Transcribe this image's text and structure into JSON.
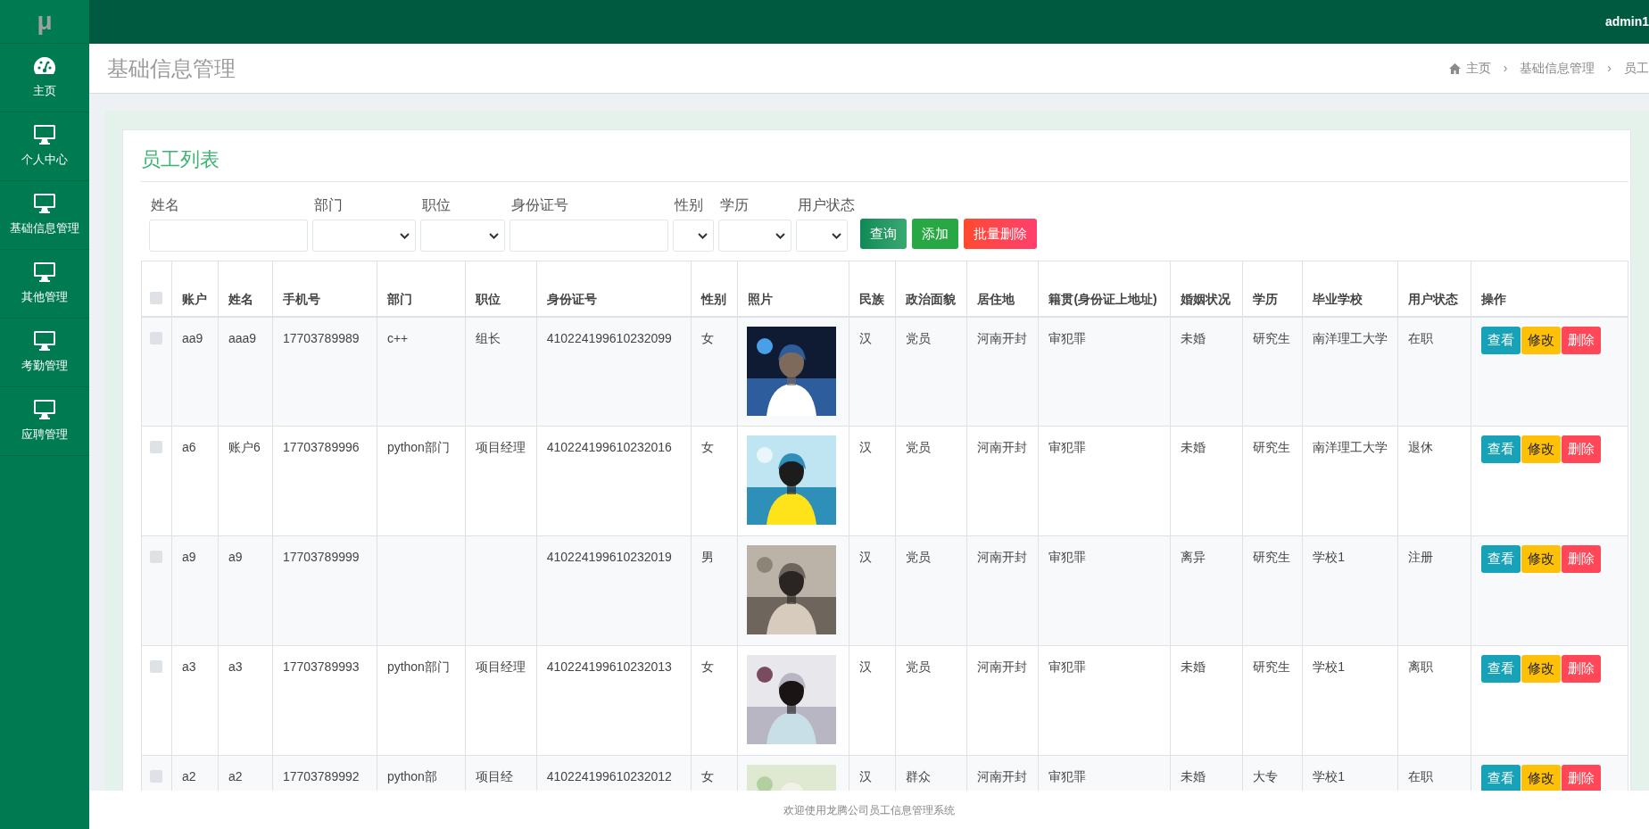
{
  "topbar": {
    "user": "admin1"
  },
  "sidebar": {
    "logo": "μ",
    "items": [
      {
        "label": "主页",
        "kind": "dashboard"
      },
      {
        "label": "个人中心",
        "kind": "monitor"
      },
      {
        "label": "基础信息管理",
        "kind": "monitor"
      },
      {
        "label": "其他管理",
        "kind": "monitor"
      },
      {
        "label": "考勤管理",
        "kind": "monitor"
      },
      {
        "label": "应聘管理",
        "kind": "monitor"
      }
    ]
  },
  "header": {
    "title": "基础信息管理",
    "breadcrumb": [
      {
        "label": "主页",
        "kind": "home"
      },
      {
        "label": "›",
        "kind": "separator"
      },
      {
        "label": "基础信息管理",
        "kind": "link"
      },
      {
        "label": "›",
        "kind": "separator"
      },
      {
        "label": "员工",
        "kind": "link"
      }
    ]
  },
  "panel": {
    "title": "员工列表",
    "filters": [
      {
        "label": "姓名",
        "kind": "text"
      },
      {
        "label": "部门",
        "kind": "select"
      },
      {
        "label": "职位",
        "kind": "select"
      },
      {
        "label": "身份证号",
        "kind": "text"
      },
      {
        "label": "性别",
        "kind": "select"
      },
      {
        "label": "学历",
        "kind": "select"
      },
      {
        "label": "用户状态",
        "kind": "select"
      }
    ],
    "buttons": [
      {
        "label": "查询",
        "kind": "search"
      },
      {
        "label": "添加",
        "kind": "add"
      },
      {
        "label": "批量删除",
        "kind": "delete"
      }
    ]
  },
  "table": {
    "select_all": {
      "checked": false
    },
    "columns": [
      {
        "label": "账户",
        "kind": "text"
      },
      {
        "label": "姓名",
        "kind": "text"
      },
      {
        "label": "手机号",
        "kind": "text"
      },
      {
        "label": "部门",
        "kind": "text"
      },
      {
        "label": "职位",
        "kind": "text"
      },
      {
        "label": "身份证号",
        "kind": "text"
      },
      {
        "label": "性别",
        "kind": "text"
      },
      {
        "label": "照片"
      },
      {
        "label": "民族",
        "kind": "text"
      },
      {
        "label": "政治面貌",
        "kind": "text"
      },
      {
        "label": "居住地",
        "kind": "text"
      },
      {
        "label": "籍贯(身份证上地址)",
        "kind": "text"
      },
      {
        "label": "婚姻状况",
        "kind": "text"
      },
      {
        "label": "学历",
        "kind": "text"
      },
      {
        "label": "毕业学校",
        "kind": "text"
      },
      {
        "label": "用户状态",
        "kind": "text"
      },
      {
        "label": "操作",
        "kind": "actions"
      }
    ],
    "rows": [
      {
        "checked": false,
        "cells": [
          "aa9",
          "aaa9",
          "17703789989",
          "c++",
          "组长",
          "410224199610232099",
          "女",
          {
            "kind": "picture"
          },
          "汉",
          "党员",
          "河南开封",
          "审犯罪",
          "未婚",
          "研究生",
          "南洋理工大学",
          "在职"
        ],
        "actions": [
          {
            "label": "查看",
            "kind": "view"
          },
          {
            "label": "修改",
            "kind": "edit"
          },
          {
            "label": "删除",
            "kind": "delete"
          }
        ]
      },
      {
        "checked": false,
        "cells": [
          "a6",
          "账户6",
          "17703789996",
          "python部门",
          "项目经理",
          "410224199610232016",
          "女",
          {
            "kind": "picture"
          },
          "汉",
          "党员",
          "河南开封",
          "审犯罪",
          "未婚",
          "研究生",
          "南洋理工大学",
          "退休"
        ],
        "actions": [
          {
            "label": "查看",
            "kind": "view"
          },
          {
            "label": "修改",
            "kind": "edit"
          },
          {
            "label": "删除",
            "kind": "delete"
          }
        ]
      },
      {
        "checked": false,
        "cells": [
          "a9",
          "a9",
          "17703789999",
          null,
          null,
          "410224199610232019",
          "男",
          {
            "kind": "picture"
          },
          "汉",
          "党员",
          "河南开封",
          "审犯罪",
          "离异",
          "研究生",
          "学校1",
          "注册"
        ],
        "actions": [
          {
            "label": "查看",
            "kind": "view"
          },
          {
            "label": "修改",
            "kind": "edit"
          },
          {
            "label": "删除",
            "kind": "delete"
          }
        ]
      },
      {
        "checked": false,
        "cells": [
          "a3",
          "a3",
          "17703789993",
          "python部门",
          "项目经理",
          "410224199610232013",
          "女",
          {
            "kind": "picture"
          },
          "汉",
          "党员",
          "河南开封",
          "审犯罪",
          "未婚",
          "研究生",
          "学校1",
          "离职"
        ],
        "actions": [
          {
            "label": "查看",
            "kind": "view"
          },
          {
            "label": "修改",
            "kind": "edit"
          },
          {
            "label": "删除",
            "kind": "delete"
          }
        ]
      },
      {
        "checked": false,
        "cells": [
          "a2",
          "a2",
          "17703789992",
          "python部",
          "项目经",
          "410224199610232012",
          "女",
          {
            "kind": "picture"
          },
          "汉",
          "群众",
          "河南开封",
          "审犯罪",
          "未婚",
          "大专",
          "学校1",
          "在职"
        ],
        "actions": [
          {
            "label": "查看",
            "kind": "view"
          },
          {
            "label": "修改",
            "kind": "edit"
          },
          {
            "label": "删除",
            "kind": "delete"
          }
        ]
      }
    ]
  },
  "footer": {
    "text": "欢迎使用龙腾公司员工信息管理系统"
  }
}
